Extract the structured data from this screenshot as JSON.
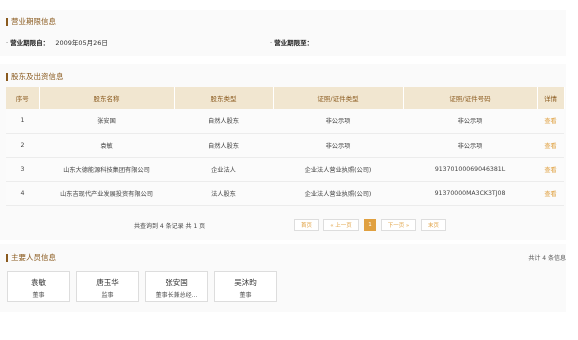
{
  "business_term": {
    "title": "营业期限信息",
    "from_label": "营业期限自：",
    "from_value": "2009年05月26日",
    "to_label": "营业期限至：",
    "to_value": ""
  },
  "shareholders": {
    "title": "股东及出资信息",
    "columns": [
      "序号",
      "股东名称",
      "股东类型",
      "证照/证件类型",
      "证照/证件号码",
      "详情"
    ],
    "rows": [
      [
        "1",
        "张安国",
        "自然人股东",
        "非公示项",
        "非公示项",
        "查看"
      ],
      [
        "2",
        "袁敏",
        "自然人股东",
        "非公示项",
        "非公示项",
        "查看"
      ],
      [
        "3",
        "山东大德能源科技集团有限公司",
        "企业法人",
        "企业法人营业执照(公司)",
        "91370100069046381L",
        "查看"
      ],
      [
        "4",
        "山东吉现代产业发展投资有限公司",
        "法人股东",
        "企业法人营业执照(公司)",
        "91370000MA3CK3TJ08",
        "查看"
      ]
    ]
  },
  "pagination": {
    "info": "共查询到 4 条记录 共 1 页",
    "first": "首页",
    "prev": "« 上一页",
    "current": "1",
    "next": "下一页 »",
    "last": "末页"
  },
  "personnel": {
    "title": "主要人员信息",
    "count": "共计 4 条信息",
    "members": [
      {
        "name": "袁敏",
        "role": "董事"
      },
      {
        "name": "唐玉华",
        "role": "监事"
      },
      {
        "name": "张安国",
        "role": "董事长兼总经..."
      },
      {
        "name": "吴沐昀",
        "role": "董事"
      }
    ]
  },
  "colors": {
    "accent": "#8a5a1e",
    "link": "#e0a040",
    "header_bg": "#f1e6d0"
  }
}
